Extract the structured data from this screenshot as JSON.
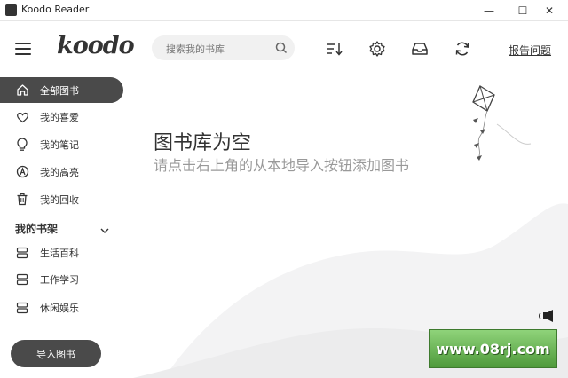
{
  "window": {
    "title": "Koodo Reader"
  },
  "header": {
    "logo": "koodo",
    "search_placeholder": "搜索我的书库",
    "report_label": "报告问题"
  },
  "sidebar": {
    "items": [
      {
        "label": "全部图书",
        "icon": "home-icon"
      },
      {
        "label": "我的喜爱",
        "icon": "heart-icon"
      },
      {
        "label": "我的笔记",
        "icon": "lightbulb-icon"
      },
      {
        "label": "我的高亮",
        "icon": "highlight-icon"
      },
      {
        "label": "我的回收",
        "icon": "trash-icon"
      }
    ],
    "shelf_header": "我的书架",
    "shelves": [
      {
        "label": "生活百科"
      },
      {
        "label": "工作学习"
      },
      {
        "label": "休闲娱乐"
      }
    ],
    "import_label": "导入图书"
  },
  "main": {
    "empty_title": "图书库为空",
    "empty_desc": "请点击右上角的从本地导入按钮添加图书"
  },
  "watermark": "www.08rj.com"
}
